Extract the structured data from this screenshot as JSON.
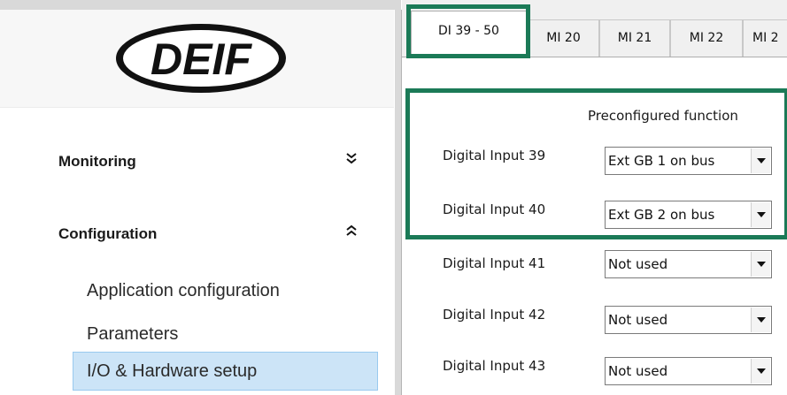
{
  "sidebar": {
    "logo_text": "DEIF",
    "sections": [
      {
        "label": "Monitoring",
        "chevron": "double-chevron-down-icon",
        "chevron_glyph": "»"
      },
      {
        "label": "Configuration",
        "chevron": "double-chevron-up-icon",
        "chevron_glyph": "»"
      }
    ],
    "config_items": [
      {
        "label": "Application configuration"
      },
      {
        "label": "Parameters"
      },
      {
        "label": "I/O & Hardware setup",
        "selected": true
      }
    ]
  },
  "tabs": [
    {
      "label": "DI 39 - 50",
      "active": true
    },
    {
      "label": "MI 20"
    },
    {
      "label": "MI 21"
    },
    {
      "label": "MI 22"
    },
    {
      "label": "MI 2"
    }
  ],
  "io_table": {
    "column_header": "Preconfigured function",
    "rows": [
      {
        "label": "Digital Input 39",
        "value": "Ext GB 1 on bus"
      },
      {
        "label": "Digital Input 40",
        "value": "Ext GB 2 on bus"
      },
      {
        "label": "Digital Input 41",
        "value": "Not used"
      },
      {
        "label": "Digital Input 42",
        "value": "Not used"
      },
      {
        "label": "Digital Input 43",
        "value": "Not used"
      }
    ]
  },
  "colors": {
    "highlight": "#1b7a57",
    "selected_bg": "#cce4f7",
    "selected_border": "#99c9ef"
  }
}
